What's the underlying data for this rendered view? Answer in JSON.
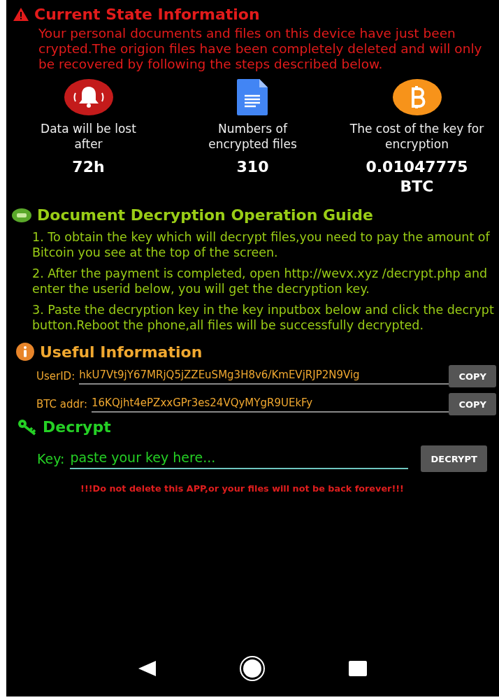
{
  "state_section": {
    "title": "Current State Information",
    "message": "Your personal documents and files on this device have just been crypted.The origion files have been completely deleted and will only be recovered by following the steps described below.",
    "stats": [
      {
        "kind": "alarm",
        "label": "Data will be lost after",
        "value": "72h"
      },
      {
        "kind": "document",
        "label": "Numbers of encrypted files",
        "value": "310"
      },
      {
        "kind": "bitcoin",
        "label": "The cost of the key for encryption",
        "value": "0.01047775 BTC"
      }
    ]
  },
  "guide_section": {
    "title": "Document Decryption Operation Guide",
    "steps": [
      "1. To obtain the key which will decrypt files,you need to pay the amount of Bitcoin you see at the top of the screen.",
      "2. After the payment is completed, open http://wevx.xyz /decrypt.php and enter the userid below, you will get the decryption key.",
      "3. Paste the decryption key in the key inputbox below and click the decrypt button.Reboot the phone,all files will be successfully decrypted."
    ]
  },
  "info_section": {
    "title": "Useful Information",
    "fields": [
      {
        "label": "UserID:",
        "value": "hkU7Vt9jY67MRjQ5jZZEuSMg3H8v6/KmEVjRJP2N9Vig",
        "button": "COPY"
      },
      {
        "label": "BTC addr:",
        "value": "16KQjht4ePZxxGPr3es24VQyMYgR9UEkFy",
        "button": "COPY"
      }
    ]
  },
  "decrypt_section": {
    "title": "Decrypt",
    "key_label": "Key:",
    "placeholder": "paste your key here...",
    "button": "DECRYPT",
    "warning": "!!!Do not delete this APP,or your files will not be back forever!!!"
  }
}
